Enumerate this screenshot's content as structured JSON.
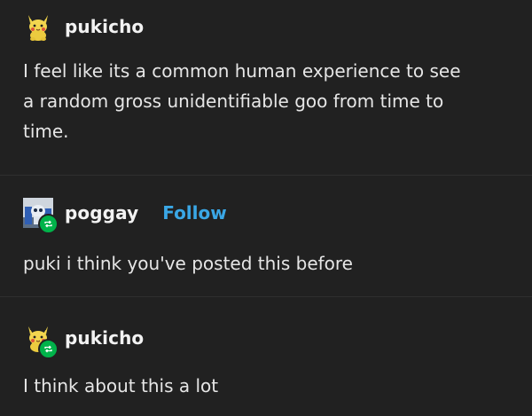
{
  "posts": [
    {
      "username": "pukicho",
      "avatar_icon": "pikachu-plush-icon",
      "text_lines": [
        "I feel like its a common human experience to see",
        "a random gross unidentifiable goo from time to",
        "time."
      ]
    },
    {
      "username": "poggay",
      "follow_label": "Follow",
      "avatar_icon": "robot-avatar-icon",
      "reblog_icon": "reblog-icon",
      "text_lines": [
        "puki i think you've posted this before"
      ]
    },
    {
      "username": "pukicho",
      "avatar_icon": "pikachu-plush-icon",
      "reblog_icon": "reblog-icon",
      "text_lines": [
        "I think about this a lot"
      ]
    }
  ],
  "colors": {
    "background": "#212121",
    "follow_link": "#3aa7e6",
    "reblog_badge": "#00b34a"
  }
}
